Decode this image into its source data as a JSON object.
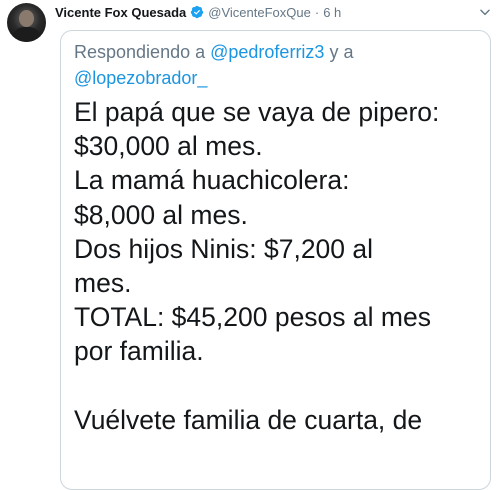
{
  "author": {
    "display_name": "Vicente Fox Quesada",
    "handle": "@VicenteFoxQue",
    "separator": "·",
    "time": "6 h"
  },
  "reply": {
    "prefix": "Respondiendo a",
    "mention_1": "@pedroferriz3",
    "conjunction": "y a",
    "mention_2": "@lopezobrador_"
  },
  "tweet": {
    "text": "El papá que se vaya de pipero:\n$30,000 al mes.\nLa mamá huachicolera:\n$8,000 al mes.\nDos hijos Ninis: $7,200 al\nmes.\nTOTAL: $45,200 pesos al mes\npor familia.\n\nVuélvete familia de cuarta, de"
  },
  "icons": {
    "verified": "verified-badge-icon",
    "menu": "chevron-down-icon"
  },
  "colors": {
    "verified": "#1da1f2",
    "mention": "#1b95e0",
    "secondary_text": "#657786",
    "border": "#ccd6dd"
  }
}
